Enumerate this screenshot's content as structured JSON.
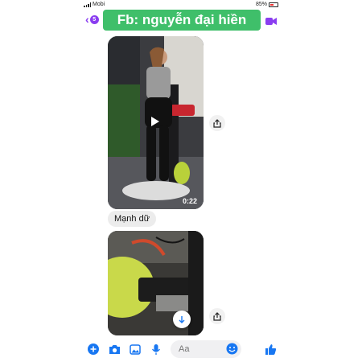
{
  "status_bar": {
    "carrier": "Mobi",
    "battery": "85%"
  },
  "header": {
    "badge_count": "5",
    "watermark": "Fb: nguyễn đại hiền"
  },
  "messages": [
    {
      "type": "video",
      "duration": "0:22"
    },
    {
      "type": "text",
      "text": "Mạnh dữ"
    },
    {
      "type": "image"
    }
  ],
  "composer": {
    "placeholder": "Aa"
  },
  "icons": [
    "back-icon",
    "video-call-icon",
    "play-icon",
    "share-icon",
    "arrow-down-icon",
    "plus-icon",
    "camera-icon",
    "gallery-icon",
    "microphone-icon",
    "emoji-icon",
    "thumbs-up-icon"
  ],
  "colors": {
    "accent": "#8a3df0",
    "messenger_blue": "#1877f2",
    "watermark_bg": "#3fbf6a"
  }
}
